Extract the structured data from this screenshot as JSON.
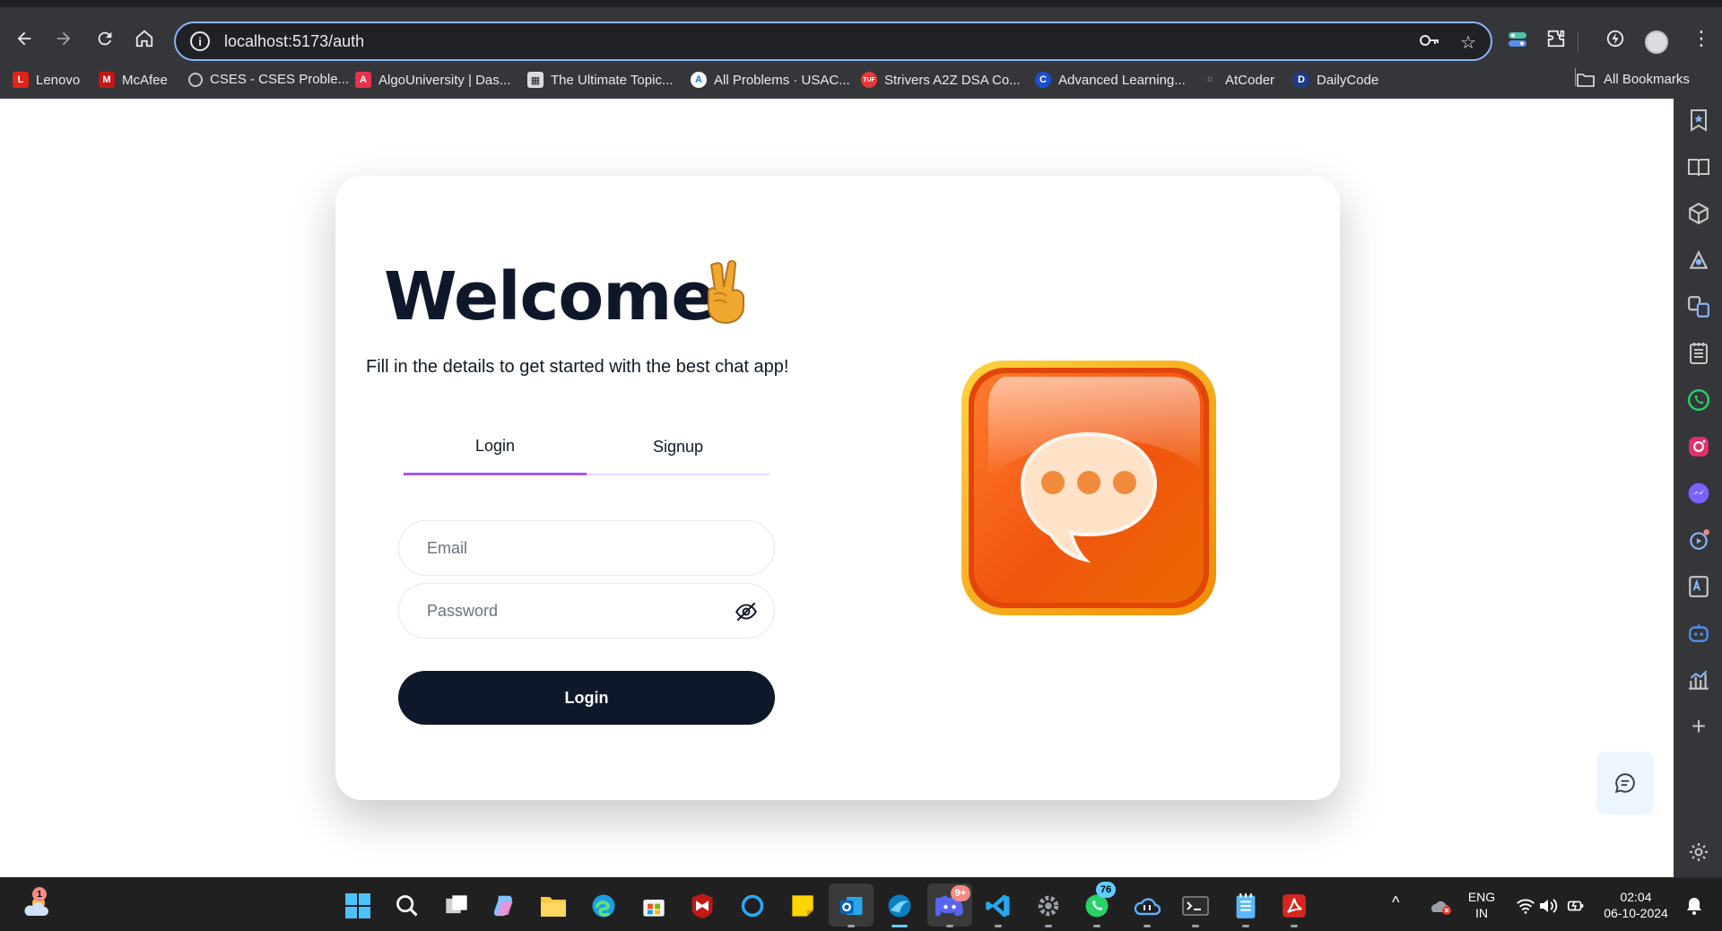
{
  "browser": {
    "url": "localhost:5173/auth",
    "bookmarks": [
      {
        "label": "Lenovo",
        "icon": "lenovo-icon",
        "color": "#e2231a"
      },
      {
        "label": "McAfee",
        "icon": "mcafee-icon",
        "color": "#c01818"
      },
      {
        "label": "CSES - CSES Proble...",
        "icon": "globe-icon",
        "color": "#5f6368"
      },
      {
        "label": "AlgoUniversity | Das...",
        "icon": "algouniversity-icon",
        "color": "#e8334a"
      },
      {
        "label": "The Ultimate Topic...",
        "icon": "page-icon",
        "color": "#9aa0a6"
      },
      {
        "label": "All Problems · USAC...",
        "icon": "usaco-icon",
        "color": "#1a73e8"
      },
      {
        "label": "Strivers A2Z DSA Co...",
        "icon": "tuf-icon",
        "color": "#e53935"
      },
      {
        "label": "Advanced Learning...",
        "icon": "c-icon",
        "color": "#1a4fd6"
      },
      {
        "label": "AtCoder",
        "icon": "atcoder-icon",
        "color": "#5f6368"
      },
      {
        "label": "DailyCode",
        "icon": "dailycode-icon",
        "color": "#1e3a8a"
      }
    ],
    "all_bookmarks": "All Bookmarks"
  },
  "auth": {
    "title": "Welcome",
    "subtitle": "Fill in the details to get started with the best chat app!",
    "tabs": [
      {
        "label": "Login",
        "active": true
      },
      {
        "label": "Signup",
        "active": false
      }
    ],
    "email_placeholder": "Email",
    "password_placeholder": "Password",
    "submit_label": "Login"
  },
  "taskbar": {
    "weather_badge": "1",
    "discord_badge": "9+",
    "whatsapp_badge": "76",
    "lang_top": "ENG",
    "lang_bottom": "IN",
    "time": "02:04",
    "date": "06-10-2024"
  },
  "colors": {
    "accent": "#a855f7",
    "button": "#0f172a",
    "omnibox_border": "#8ab4f8"
  }
}
